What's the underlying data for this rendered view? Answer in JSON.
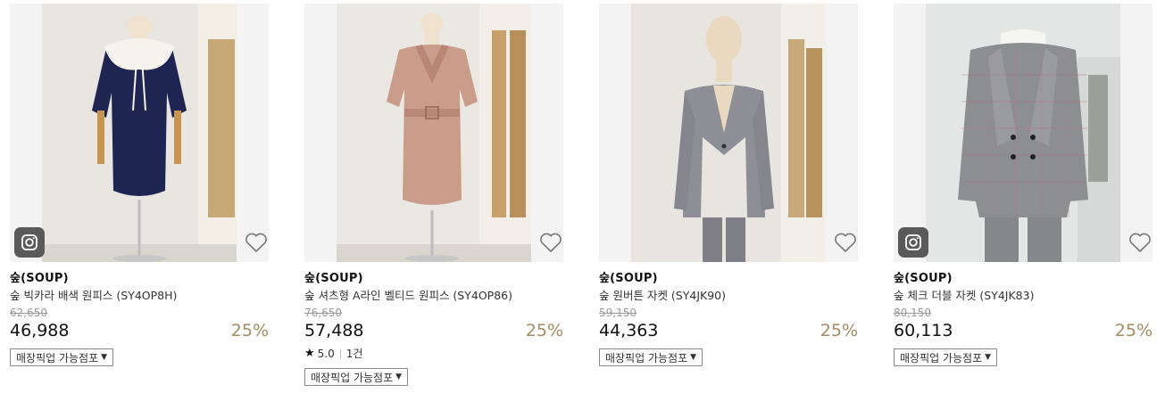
{
  "products": [
    {
      "brand": "숲(SOUP)",
      "name": "숲 빅카라 배색 원피스 (SY4OP8H)",
      "original_price": "62,650",
      "price": "46,988",
      "discount": "25%",
      "pickup_label": "매장픽업 가능점포",
      "has_instagram_badge": true,
      "image": "navy dress with white collar on mannequin"
    },
    {
      "brand": "숲(SOUP)",
      "name": "숲 셔츠형 A라인 벨티드 원피스 (SY4OP86)",
      "original_price": "76,650",
      "price": "57,488",
      "discount": "25%",
      "rating": "5.0",
      "review_count": "1건",
      "pickup_label": "매장픽업 가능점포",
      "has_instagram_badge": false,
      "image": "pink belted shirt dress on mannequin"
    },
    {
      "brand": "숲(SOUP)",
      "name": "숲 원버튼 자켓 (SY4JK90)",
      "original_price": "59,150",
      "price": "44,363",
      "discount": "25%",
      "pickup_label": "매장픽업 가능점포",
      "has_instagram_badge": false,
      "image": "grey one-button suit jacket on mannequin"
    },
    {
      "brand": "숲(SOUP)",
      "name": "숲 체크 더블 자켓 (SY4JK83)",
      "original_price": "80,150",
      "price": "60,113",
      "discount": "25%",
      "pickup_label": "매장픽업 가능점포",
      "has_instagram_badge": true,
      "image": "grey check double-breasted jacket on mannequin"
    }
  ],
  "icons": {
    "wishlist": "heart-outline-icon",
    "instagram": "instagram-icon",
    "rating": "star-icon",
    "dropdown": "caret-down-icon"
  },
  "colors": {
    "discount": "#a38b63",
    "badge_bg": "#5a5a5a",
    "strike_price": "#9a9a9a"
  }
}
